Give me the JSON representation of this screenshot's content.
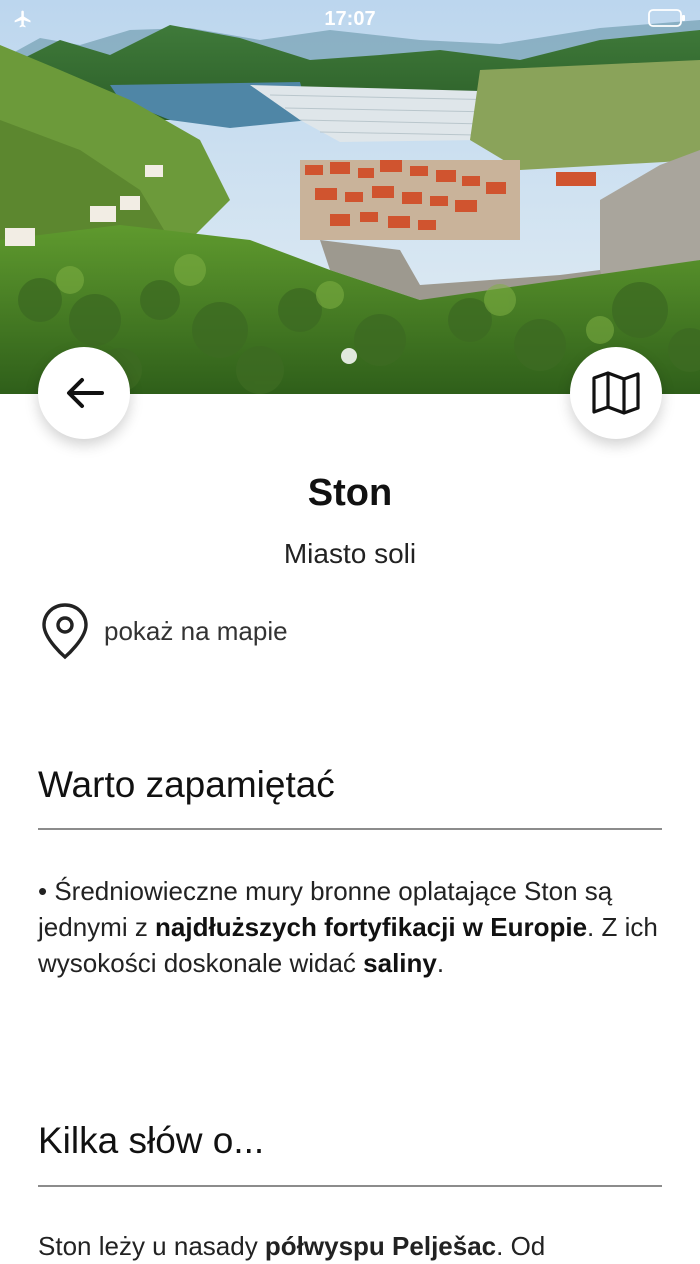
{
  "status": {
    "time": "17:07"
  },
  "hero": {
    "pager_dots": 1
  },
  "place": {
    "title": "Ston",
    "subtitle": "Miasto soli",
    "show_on_map": "pokaż na mapie"
  },
  "sections": {
    "remember": {
      "title": "Warto zapamiętać",
      "text": {
        "t1": "• Średniowieczne mury bronne oplatające Ston są jednymi z ",
        "b1": "najdłuższych fortyfikacji w Europie",
        "t2": ". Z ich wysokości doskonale widać ",
        "b2": "saliny",
        "t3": "."
      }
    },
    "about": {
      "title": "Kilka słów o...",
      "text": {
        "t1": "Ston leży u nasady ",
        "b1": "półwyspu Pelješac",
        "t2": ". Od"
      }
    }
  },
  "icons": {
    "back": "arrow-left-icon",
    "map": "map-icon",
    "pin": "location-pin-icon",
    "plane": "airplane-icon",
    "battery": "battery-icon"
  }
}
